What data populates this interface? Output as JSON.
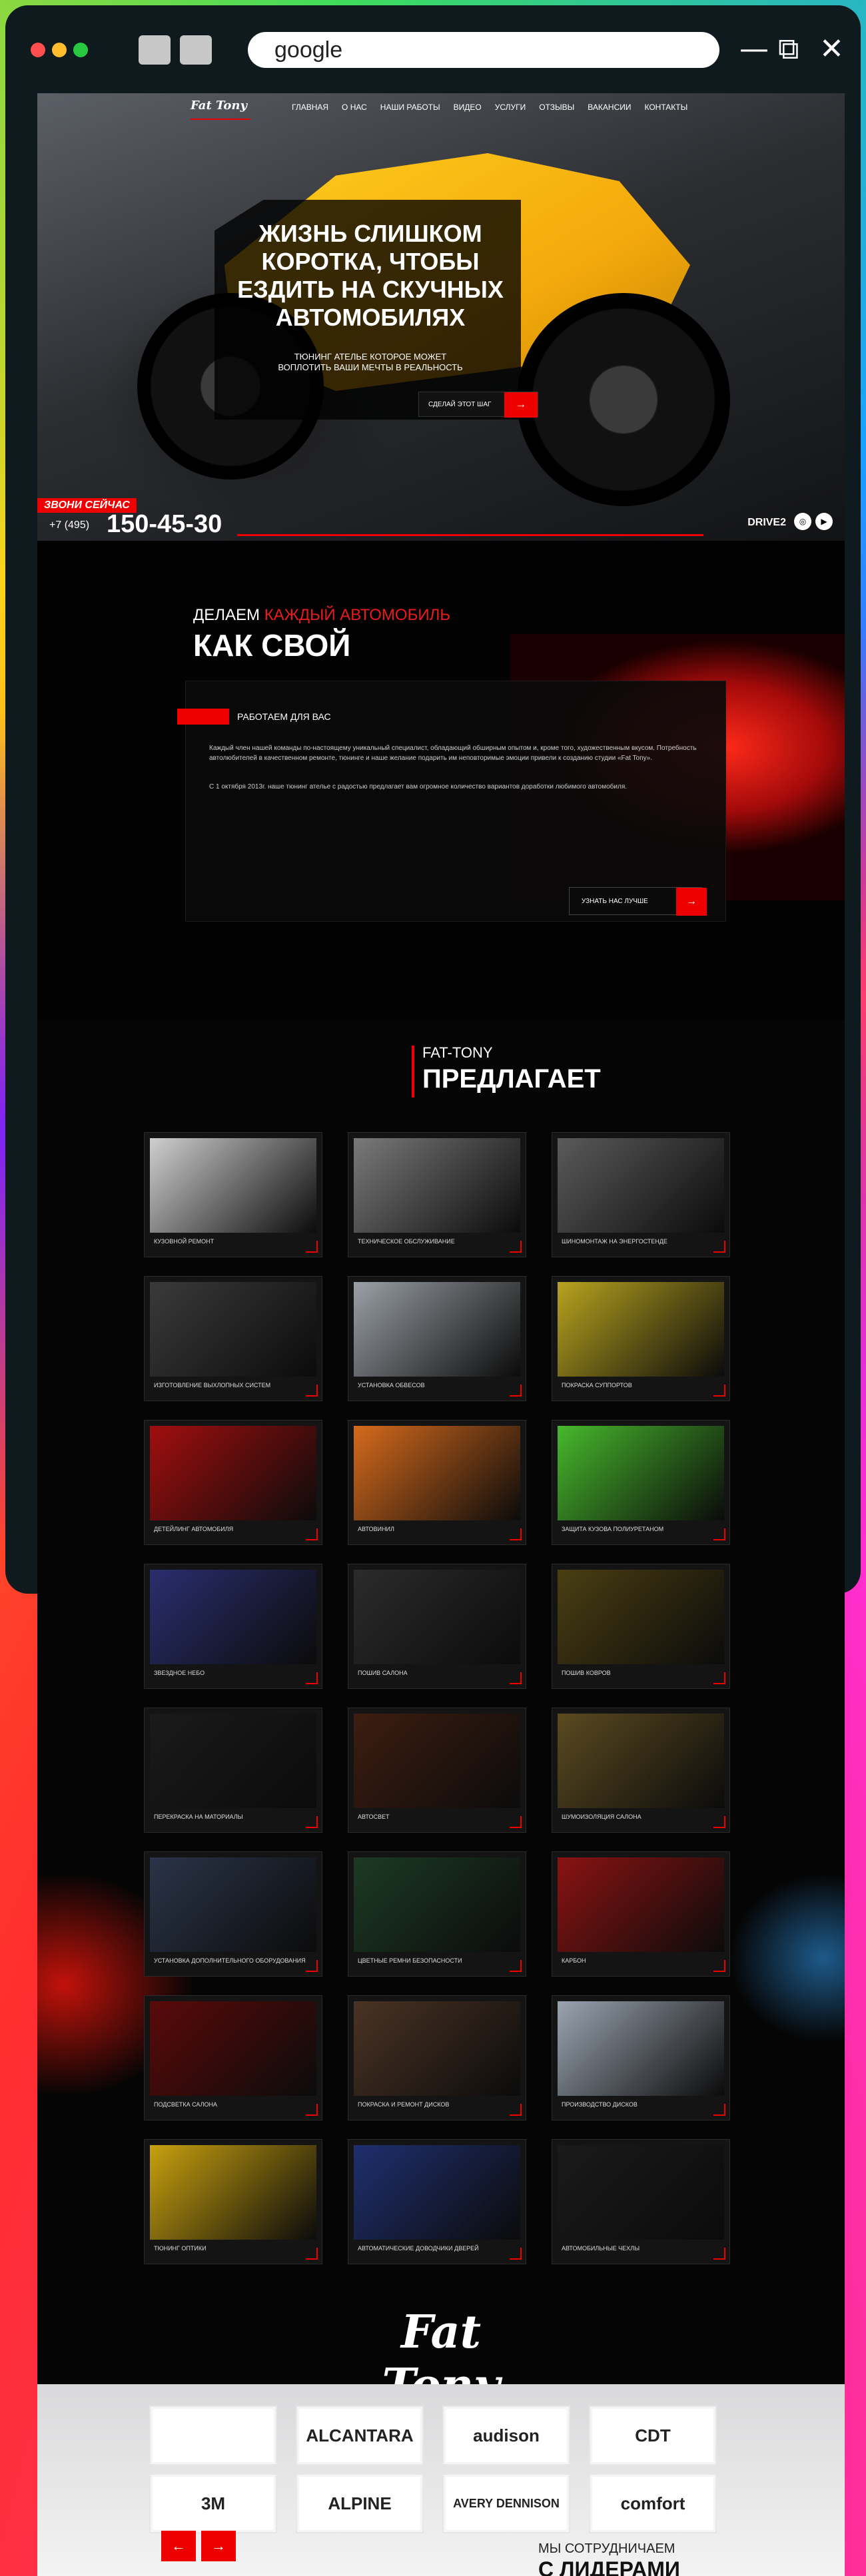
{
  "browser": {
    "url": "google"
  },
  "nav": [
    "ГЛАВНАЯ",
    "О НАС",
    "НАШИ РАБОТЫ",
    "ВИДЕО",
    "УСЛУГИ",
    "ОТЗЫВЫ",
    "ВАКАНСИИ",
    "КОНТАКТЫ"
  ],
  "hero": {
    "title": "ЖИЗНЬ СЛИШКОМ КОРОТКА, ЧТОБЫ ЕЗДИТЬ НА СКУЧНЫХ АВТОМОБИЛЯХ",
    "subtitle": "ТЮНИНГ АТЕЛЬЕ КОТОРОЕ МОЖЕТ ВОПЛОТИТЬ ВАШИ МЕЧТЫ В РЕАЛЬНОСТЬ",
    "button": "СДЕЛАЙ ЭТОТ ШАГ",
    "call_now": "ЗВОНИ СЕЙЧАС",
    "phone_prefix": "+7 (495)",
    "phone_number": "150-45-30",
    "drive2": "DRIVE2"
  },
  "about": {
    "tag_white": "ДЕЛАЕМ",
    "tag_red": "КАЖДЫЙ АВТОМОБИЛЬ",
    "heading": "КАК СВОЙ",
    "sub": "РАБОТАЕМ ДЛЯ ВАС",
    "p1": "Каждый член нашей команды по-настоящему уникальный специалист, обладающий обширным опытом и, кроме того, художественным вкусом. Потребность автолюбителей в качественном ремонте, тюнинге и наше желание подарить им неповторимые эмоции привели к созданию студии «Fat Tony».",
    "p2": "С 1 октября 2013г. наше тюнинг ателье с радостью предлагает вам огромное количество вариантов доработки любимого автомобиля.",
    "button": "УЗНАТЬ НАС ЛУЧШЕ"
  },
  "offers": {
    "brand": "FAT-TONY",
    "heading": "ПРЕДЛАГАЕТ",
    "cards": [
      {
        "label": "КУЗОВНОЙ РЕМОНТ",
        "color": "#cfcfcf"
      },
      {
        "label": "ТЕХНИЧЕСКОЕ ОБСЛУЖИВАНИЕ",
        "color": "#7a7a7a"
      },
      {
        "label": "ШИНОМОНТАЖ НА ЭНЕРГОСТЕНДЕ",
        "color": "#5a5a5a"
      },
      {
        "label": "ИЗГОТОВЛЕНИЕ ВЫХЛОПНЫХ СИСТЕМ",
        "color": "#3a3a3a"
      },
      {
        "label": "УСТАНОВКА ОБВЕСОВ",
        "color": "#9aa0a6"
      },
      {
        "label": "ПОКРАСКА СУППОРТОВ",
        "color": "#b8a31f"
      },
      {
        "label": "ДЕТЕЙЛИНГ АВТОМОБИЛЯ",
        "color": "#a10e0e"
      },
      {
        "label": "АВТОВИНИЛ",
        "color": "#d56a1c"
      },
      {
        "label": "ЗАЩИТА КУЗОВА ПОЛИУРЕТАНОМ",
        "color": "#47b82c"
      },
      {
        "label": "ЗВЕЗДНОЕ НЕБО",
        "color": "#2a2e6e"
      },
      {
        "label": "ПОШИВ САЛОНА",
        "color": "#2b2b2b"
      },
      {
        "label": "ПОШИВ КОВРОВ",
        "color": "#4a3e12"
      },
      {
        "label": "ПЕРЕКРАСКА НА МАТОРИАЛЫ",
        "color": "#1a1a1a"
      },
      {
        "label": "АВТОСВЕТ",
        "color": "#3d1d10"
      },
      {
        "label": "ШУМОИЗОЛЯЦИЯ САЛОНА",
        "color": "#5a4a20"
      },
      {
        "label": "УСТАНОВКА ДОПОЛНИТЕЛЬНОГО ОБОРУДОВАНИЯ",
        "color": "#2a3448"
      },
      {
        "label": "ЦВЕТНЫЕ РЕМНИ БЕЗОПАСНОСТИ",
        "color": "#1c3a24"
      },
      {
        "label": "КАРБОН",
        "color": "#8a1212"
      },
      {
        "label": "ПОДСВЕТКА САЛОНА",
        "color": "#5a0a0a"
      },
      {
        "label": "ПОКРАСКА И РЕМОНТ ДИСКОВ",
        "color": "#4a3324"
      },
      {
        "label": "ПРОИЗВОДСТВО ДИСКОВ",
        "color": "#9aa4b0"
      },
      {
        "label": "ТЮНИНГ ОПТИКИ",
        "color": "#c8a10e"
      },
      {
        "label": "АВТОМАТИЧЕСКИЕ ДОВОДЧИКИ ДВЕРЕЙ",
        "color": "#1f2f6e"
      },
      {
        "label": "АВТОМОБИЛЬНЫЕ ЧЕХЛЫ",
        "color": "#1a1a1a"
      }
    ]
  },
  "footer": {
    "logo": "Fat Tony",
    "partners": [
      "",
      "ALCANTARA",
      "audison",
      "CDT",
      "3M",
      "ALPINE",
      "AVERY DENNISON",
      "comfort"
    ],
    "coop_small": "МЫ СОТРУДНИЧАЕМ",
    "coop_big": "С ЛИДЕРАМИ"
  }
}
